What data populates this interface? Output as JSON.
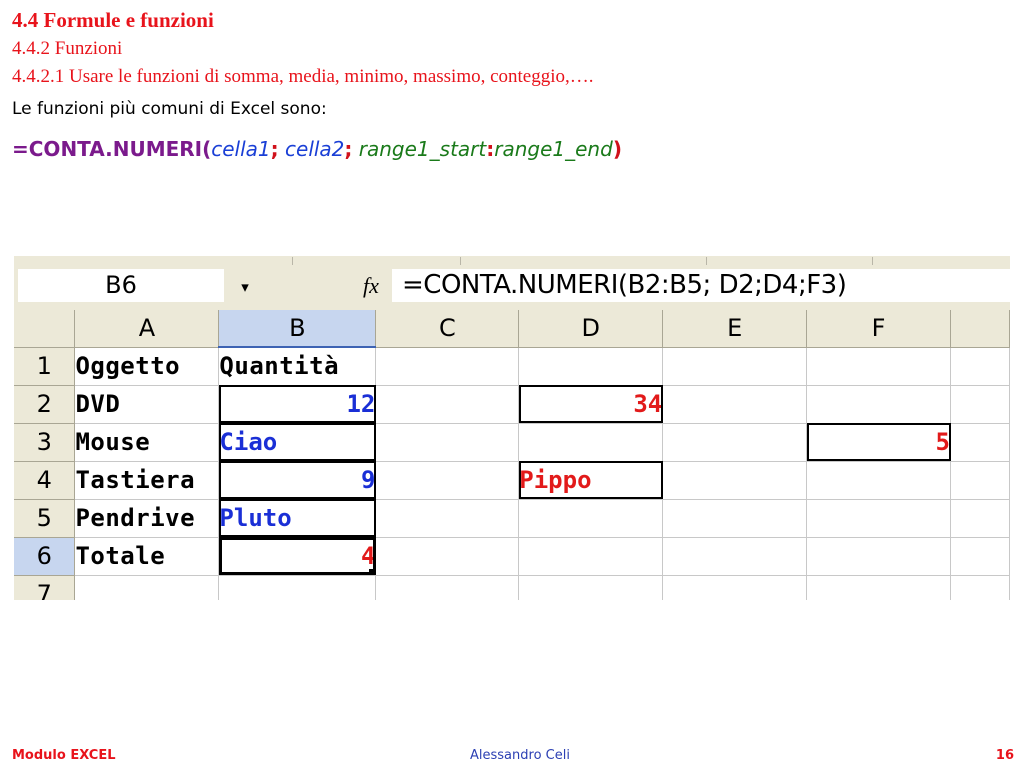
{
  "slide": {
    "heading1": "4.4 Formule e funzioni",
    "heading2": "4.4.2  Funzioni",
    "heading3": "4.4.2.1 Usare le funzioni di somma, media, minimo, massimo, conteggio,….",
    "intro": "Le funzioni più comuni di Excel sono:",
    "formula": {
      "function": "=CONTA.NUMERI(",
      "arg1": "cella1",
      "sep1": ";",
      "arg2": "cella2",
      "sep2": ";",
      "arg3_start": "range1_start",
      "colon": ":",
      "arg3_end": "range1_end",
      "close": ")"
    }
  },
  "excel": {
    "namebox": "B6",
    "dropdown_icon": "▾",
    "fx_label": "fx",
    "formula_text": "=CONTA.NUMERI(B2:B5; D2;D4;F3)",
    "columns": [
      "A",
      "B",
      "C",
      "D",
      "E",
      "F"
    ],
    "selected_column": "B",
    "rows": [
      {
        "n": "1",
        "A": "Oggetto",
        "B": "Quantità",
        "C": "",
        "D": "",
        "E": "",
        "F": ""
      },
      {
        "n": "2",
        "A": "DVD",
        "B": "12",
        "C": "",
        "D": "34",
        "E": "",
        "F": ""
      },
      {
        "n": "3",
        "A": "Mouse",
        "B": "Ciao",
        "C": "",
        "D": "",
        "E": "",
        "F": "5"
      },
      {
        "n": "4",
        "A": "Tastiera",
        "B": "9",
        "C": "",
        "D": "Pippo",
        "E": "",
        "F": ""
      },
      {
        "n": "5",
        "A": "Pendrive",
        "B": "Pluto",
        "C": "",
        "D": "",
        "E": "",
        "F": ""
      },
      {
        "n": "6",
        "A": "Totale",
        "B": "4",
        "C": "",
        "D": "",
        "E": "",
        "F": ""
      },
      {
        "n": "7",
        "A": "",
        "B": "",
        "C": "",
        "D": "",
        "E": "",
        "F": ""
      }
    ],
    "selected_row": "6",
    "active_cell": "B6",
    "colors": {
      "number_blue": "#1a2fd6",
      "highlight_red": "#e21a1a",
      "header_selected": "#c7d6ef"
    }
  },
  "footer": {
    "left": "Modulo  EXCEL",
    "center": "Alessandro Celi",
    "page": "16"
  }
}
